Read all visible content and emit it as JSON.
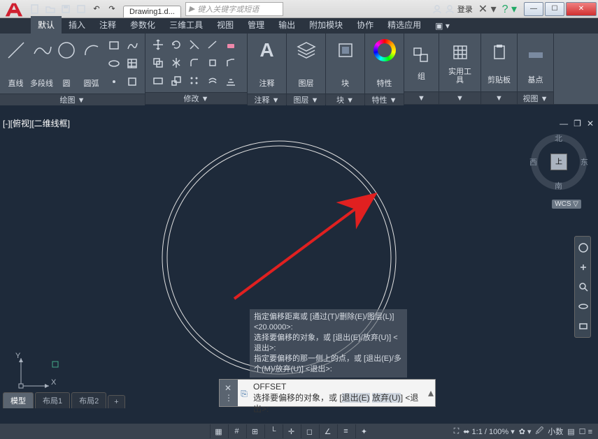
{
  "qat": {
    "search_placeholder": "键入关键字或短语",
    "login": "登录"
  },
  "doc_tab": "Drawing1.d...",
  "tabs": [
    "默认",
    "插入",
    "注释",
    "参数化",
    "三维工具",
    "视图",
    "管理",
    "输出",
    "附加模块",
    "协作",
    "精选应用"
  ],
  "panels": {
    "draw": {
      "title": "绘图 ▼",
      "line": "直线",
      "polyline": "多段线",
      "circle": "圆",
      "arc": "圆弧"
    },
    "modify": {
      "title": "修改 ▼"
    },
    "annotate": {
      "title": "注释 ▼",
      "label": "注释"
    },
    "layers": {
      "title": "图层 ▼",
      "label": "图层"
    },
    "blocks": {
      "title": "块 ▼",
      "label": "块"
    },
    "props": {
      "title": "特性 ▼",
      "label": "特性"
    },
    "group": {
      "label": "组"
    },
    "util": {
      "label": "实用工具"
    },
    "clip": {
      "label": "剪贴板"
    },
    "base": {
      "label": "基点"
    },
    "view": {
      "title": "视图 ▼"
    }
  },
  "viewport": {
    "label": "[-][俯视][二维线框]",
    "cube": {
      "n": "北",
      "s": "南",
      "e": "东",
      "w": "西",
      "face": "上"
    },
    "wcs": "WCS ▽"
  },
  "history": {
    "l1": "指定偏移距离或 [通过(T)/删除(E)/图层(L)] <20.0000>:",
    "l2": "选择要偏移的对象，或 [退出(E)/放弃(U)] <退出>:",
    "l3": "指定要偏移的那一侧上的点，或 [退出(E)/多个(M)/放弃(U)] <退出>:"
  },
  "cmdline": {
    "name": "OFFSET",
    "prompt_a": "选择要偏移的对象，或 [",
    "exit_kw": "退出(E)",
    "undo_kw": "放弃(U)",
    "prompt_b": "] <退出>:"
  },
  "bottom_tabs": {
    "model": "模型",
    "layout1": "布局1",
    "layout2": "布局2"
  },
  "status": {
    "scale": "1:1 / 100%",
    "style": "小数"
  },
  "ucs": {
    "x": "X",
    "y": "Y"
  }
}
